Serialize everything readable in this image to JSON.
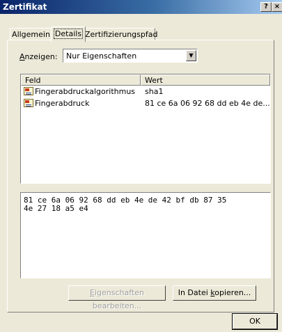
{
  "window": {
    "title": "Zertifikat",
    "help_label": "?",
    "close_label": "×"
  },
  "tabs": [
    {
      "label": "Allgemein"
    },
    {
      "label": "Details"
    },
    {
      "label": "Zertifizierungspfad"
    }
  ],
  "show": {
    "label_pre": "",
    "label_accel": "A",
    "label_post": "nzeigen:",
    "selected": "Nur Eigenschaften",
    "arrow": "▼"
  },
  "fields": {
    "columns": [
      "Feld",
      "Wert"
    ],
    "rows": [
      {
        "field": "Fingerabdruckalgorithmus",
        "value": "sha1",
        "icon": "certificate-icon"
      },
      {
        "field": "Fingerabdruck",
        "value": "81 ce 6a 06 92 68 dd eb 4e de...",
        "icon": "certificate-icon"
      }
    ]
  },
  "detail_text": "81 ce 6a 06 92 68 dd eb 4e de 42 bf db 87 35\n4e 27 18 a5 e4",
  "buttons": {
    "edit_pre": "",
    "edit_accel": "E",
    "edit_post": "igenschaften bearbeiten...",
    "copy_pre": "In Datei ",
    "copy_accel": "k",
    "copy_post": "opieren...",
    "ok": "OK"
  }
}
